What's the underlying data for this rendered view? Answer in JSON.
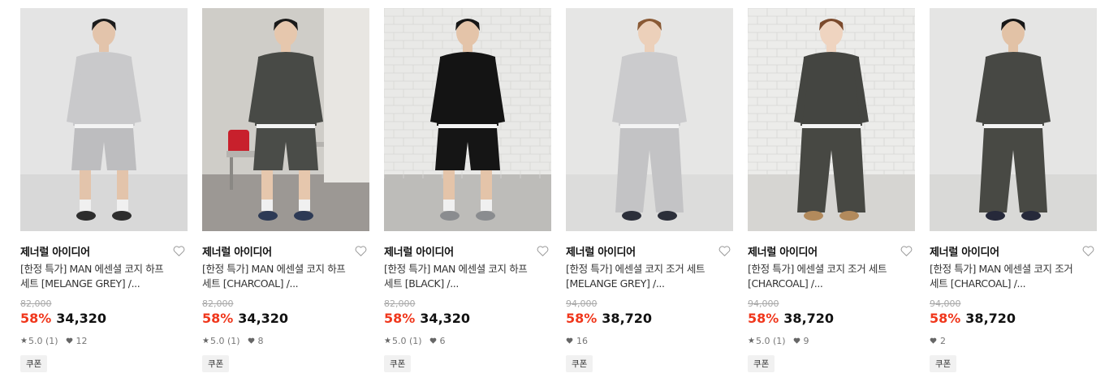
{
  "products": [
    {
      "brand": "제너럴 아이디어",
      "title_line1": "[한정 특가] MAN 에센셜 코지 하프",
      "title_line2": "세트 [MELANGE GREY] /...",
      "original_price": "82,000",
      "discount": "58%",
      "price": "34,320",
      "rating": "5.0 (1)",
      "likes": "12",
      "coupon": "쿠폰",
      "image": {
        "bg": "#e4e4e4",
        "floor": "#d8d8d8",
        "top": "#c9c9cb",
        "bottom": "#bdbdbf",
        "skin": "#e3c4ab",
        "hair": "#1c1c1c",
        "bottom_type": "shorts",
        "shoes": "#2d2d2d",
        "scene": "studio"
      }
    },
    {
      "brand": "제너럴 아이디어",
      "title_line1": "[한정 특가] MAN 에센셜 코지 하프",
      "title_line2": "세트 [CHARCOAL] /...",
      "original_price": "82,000",
      "discount": "58%",
      "price": "34,320",
      "rating": "5.0 (1)",
      "likes": "8",
      "coupon": "쿠폰",
      "image": {
        "bg": "#cfcdc8",
        "floor": "#9c9894",
        "top": "#484a46",
        "bottom": "#4a4c48",
        "skin": "#e6c7ad",
        "hair": "#1a1a1a",
        "bottom_type": "shorts",
        "shoes": "#2d3a55",
        "scene": "chairs"
      }
    },
    {
      "brand": "제너럴 아이디어",
      "title_line1": "[한정 특가] MAN 에센셜 코지 하프",
      "title_line2": "세트 [BLACK] /...",
      "original_price": "82,000",
      "discount": "58%",
      "price": "34,320",
      "rating": "5.0 (1)",
      "likes": "6",
      "coupon": "쿠폰",
      "image": {
        "bg": "#e9e9e7",
        "floor": "#bdbcb9",
        "top": "#141414",
        "bottom": "#151515",
        "skin": "#e4c4a9",
        "hair": "#161616",
        "bottom_type": "shorts",
        "shoes": "#8a8c8f",
        "scene": "brick"
      }
    },
    {
      "brand": "제너럴 아이디어",
      "title_line1": "[한정 특가] 에센셜 코지 조거 세트",
      "title_line2": "[MELANGE GREY] /...",
      "original_price": "94,000",
      "discount": "58%",
      "price": "38,720",
      "rating": "",
      "likes": "16",
      "coupon": "쿠폰",
      "image": {
        "bg": "#e6e6e5",
        "floor": "#dcdcdb",
        "top": "#cbcbcd",
        "bottom": "#c3c3c5",
        "skin": "#ecd0ba",
        "hair": "#8a5a35",
        "bottom_type": "pants",
        "shoes": "#2c2f3a",
        "scene": "studio"
      }
    },
    {
      "brand": "제너럴 아이디어",
      "title_line1": "[한정 특가] 에센셜 코지 조거 세트",
      "title_line2": "[CHARCOAL] /...",
      "original_price": "94,000",
      "discount": "58%",
      "price": "38,720",
      "rating": "5.0 (1)",
      "likes": "9",
      "coupon": "쿠폰",
      "image": {
        "bg": "#ececea",
        "floor": "#d6d5d2",
        "top": "#444541",
        "bottom": "#474843",
        "skin": "#efd4c0",
        "hair": "#7b4a2c",
        "bottom_type": "pants",
        "shoes": "#b28a5c",
        "scene": "brick"
      }
    },
    {
      "brand": "제너럴 아이디어",
      "title_line1": "[한정 특가] MAN 에센셜 코지 조거",
      "title_line2": "세트 [CHARCOAL] /...",
      "original_price": "94,000",
      "discount": "58%",
      "price": "38,720",
      "rating": "",
      "likes": "2",
      "coupon": "쿠폰",
      "image": {
        "bg": "#e5e5e4",
        "floor": "#d9d9d7",
        "top": "#474844",
        "bottom": "#484944",
        "skin": "#e2c2a6",
        "hair": "#171717",
        "bottom_type": "pants",
        "shoes": "#26293a",
        "scene": "studio"
      }
    }
  ]
}
